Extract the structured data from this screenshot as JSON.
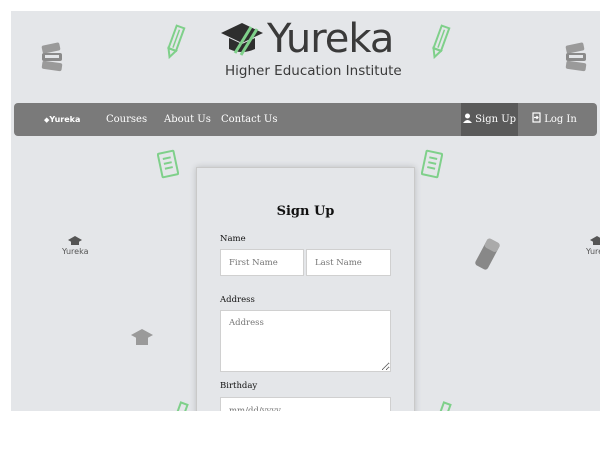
{
  "brand": {
    "name": "Yureka",
    "tagline": "Higher Education Institute",
    "small_name": "Yureka",
    "small_tagline": "Higher Education Institute"
  },
  "navbar": {
    "brand": "Yureka",
    "items": [
      {
        "label": "Courses"
      },
      {
        "label": "About Us"
      },
      {
        "label": "Contact Us"
      }
    ],
    "signup": "Sign Up",
    "login": "Log In"
  },
  "form": {
    "title": "Sign Up",
    "name_label": "Name",
    "first_name_placeholder": "First Name",
    "last_name_placeholder": "Last Name",
    "address_label": "Address",
    "address_placeholder": "Address",
    "birthday_label": "Birthday",
    "birthday_placeholder": "mm/dd/yyyy"
  },
  "colors": {
    "background": "#e4e6e9",
    "navbar": "#7a7a7a",
    "navbar_active": "#5a5a5a",
    "accent": "#7fd08a",
    "logo_text": "#3a3a3a"
  }
}
